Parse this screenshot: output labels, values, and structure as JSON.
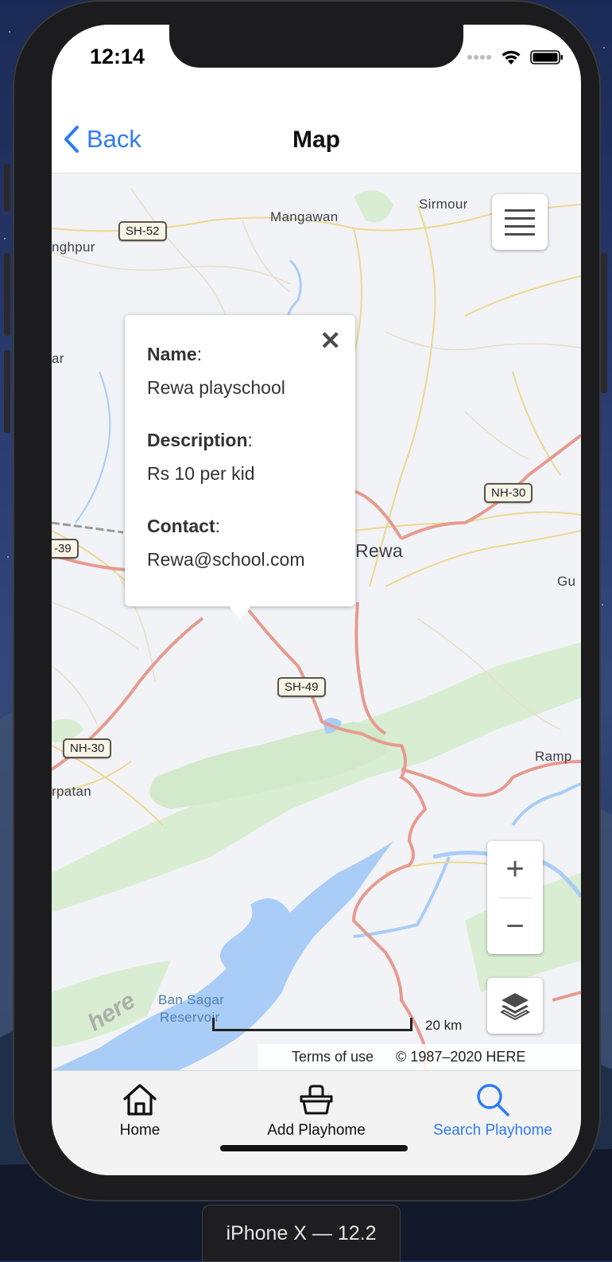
{
  "status_bar": {
    "time": "12:14"
  },
  "nav": {
    "back_label": "Back",
    "title": "Map"
  },
  "map": {
    "places": [
      {
        "key": "mangawan",
        "label": "Mangawan"
      },
      {
        "key": "sirmour",
        "label": "Sirmour"
      },
      {
        "key": "nghpur",
        "label": "nghpur"
      },
      {
        "key": "ar",
        "label": "ar"
      },
      {
        "key": "rewa",
        "label": "Rewa"
      },
      {
        "key": "gu",
        "label": "Gu"
      },
      {
        "key": "rampur",
        "label": "Ramp"
      },
      {
        "key": "rpatan",
        "label": "rpatan"
      },
      {
        "key": "bansagar1",
        "label": "Ban Sagar"
      },
      {
        "key": "bansagar2",
        "label": "Reservoir"
      }
    ],
    "shields": {
      "sh52": "SH-52",
      "nh30a": "NH-30",
      "nh30b": "NH-30",
      "s39": "-39",
      "sh49": "SH-49"
    },
    "popup": {
      "name_label": "Name",
      "name_value": "Rewa playschool",
      "description_label": "Description",
      "description_value": "Rs 10 per kid",
      "contact_label": "Contact",
      "contact_value": "Rewa@school.com",
      "close_glyph": "✕"
    },
    "zoom_in": "+",
    "zoom_out": "−",
    "scale_label": "20 km",
    "terms": "Terms of use",
    "copyright": "© 1987–2020 HERE",
    "logo_text": "here",
    "colors": {
      "water": "#a9cdf6",
      "park": "#d7ecd1",
      "highway": "#e79a8e",
      "road": "#ecd98f"
    }
  },
  "tabs": [
    {
      "label": "Home",
      "icon": "home-icon",
      "active": false
    },
    {
      "label": "Add Playhome",
      "icon": "basket-icon",
      "active": false
    },
    {
      "label": "Search Playhome",
      "icon": "search-icon",
      "active": true
    }
  ],
  "device": {
    "label": "iPhone X — 12.2"
  },
  "accent_color": "#2f7bf6"
}
